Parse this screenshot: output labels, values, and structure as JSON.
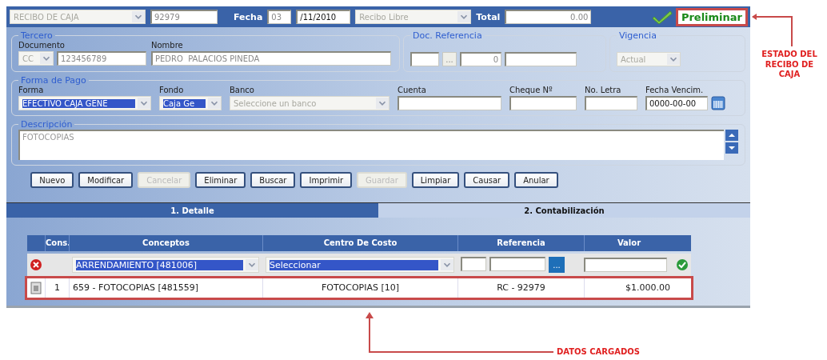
{
  "header": {
    "document_type": "RECIBO DE CAJA",
    "number": "92979",
    "date_label": "Fecha",
    "day": "03",
    "month_year": "/11/2010",
    "receipt_kind": "Recibo Libre",
    "total_label": "Total",
    "total": "0.00",
    "status": "Preliminar"
  },
  "tercero": {
    "legend": "Tercero",
    "documento_label": "Documento",
    "doc_type": "CC",
    "doc_number": "123456789",
    "nombre_label": "Nombre",
    "nombre": "PEDRO  PALACIOS PINEDA"
  },
  "doc_referencia": {
    "legend": "Doc. Referencia",
    "button": "...",
    "number": "0"
  },
  "vigencia": {
    "legend": "Vigencia",
    "value": "Actual"
  },
  "forma_pago": {
    "legend": "Forma de Pago",
    "fields": [
      {
        "kind": "select",
        "label": "Forma",
        "value": "EFECTIVO CAJA GENE",
        "highlighted": true
      },
      {
        "kind": "select",
        "label": "Fondo",
        "value": "Caja Ge",
        "highlighted": true
      },
      {
        "kind": "select",
        "label": "Banco",
        "value": "Seleccione un banco",
        "highlighted": false
      },
      {
        "kind": "input",
        "label": "Cuenta"
      },
      {
        "kind": "input",
        "label": "Cheque Nº"
      },
      {
        "kind": "input",
        "label": "No. Letra"
      },
      {
        "kind": "date",
        "label": "Fecha Vencim.",
        "value": "0000-00-00"
      }
    ]
  },
  "descripcion": {
    "legend": "Descripción",
    "value": "FOTOCOPIAS"
  },
  "buttons": [
    {
      "label": "Nuevo",
      "disabled": false
    },
    {
      "label": "Modificar",
      "disabled": false
    },
    {
      "label": "Cancelar",
      "disabled": true
    },
    {
      "label": "Eliminar",
      "disabled": false
    },
    {
      "label": "Buscar",
      "disabled": false
    },
    {
      "label": "Imprimir",
      "disabled": false
    },
    {
      "label": "Guardar",
      "disabled": true
    },
    {
      "label": "Limpiar",
      "disabled": false
    },
    {
      "label": "Causar",
      "disabled": false
    },
    {
      "label": "Anular",
      "disabled": false
    }
  ],
  "tabs": [
    {
      "label": "1. Detalle",
      "selected": true
    },
    {
      "label": "2. Contabilización",
      "selected": false
    }
  ],
  "grid": {
    "columns": [
      "Cons.",
      "Conceptos",
      "Centro De Costo",
      "Referencia",
      "Valor"
    ],
    "entry": {
      "concepto": "ARRENDAMIENTO [481006]",
      "centro": "Seleccionar",
      "ref_button": "..."
    },
    "rows": [
      {
        "cons": "1",
        "concepto": "659 - FOTOCOPIAS [481559]",
        "centro": "FOTOCOPIAS [10]",
        "referencia": "RC - 92979",
        "valor": "$1.000.00"
      }
    ]
  },
  "annotations": [
    "ESTADO DEL RECIBO DE CAJA",
    "DATOS CARGADOS"
  ]
}
